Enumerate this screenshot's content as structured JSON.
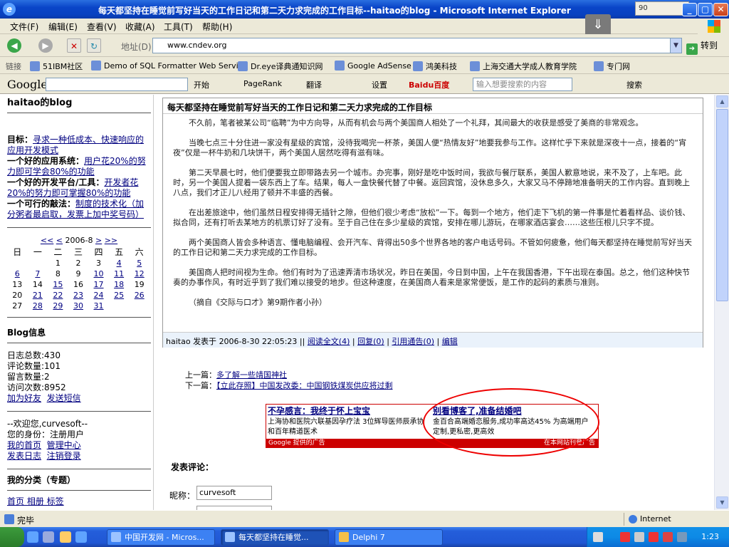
{
  "window": {
    "title": "每天都坚持在睡觉前写好当天的工作日记和第二天力求完成的工作目标--haitao的blog - Microsoft Internet Explorer",
    "tray_top_text": "90"
  },
  "menu": [
    "文件(F)",
    "编辑(E)",
    "查看(V)",
    "收藏(A)",
    "工具(T)",
    "帮助(H)"
  ],
  "address": {
    "label": "地址(D)",
    "url": "www.cndev.org",
    "go_label": "转到"
  },
  "links": {
    "label": "链接",
    "items": [
      "51IBM社区",
      "Demo of SQL Formatter Web Service",
      "Dr.eye译典通知识网",
      "Google AdSense",
      "鸿美科技",
      "上海交通大学成人教育学院",
      "专门网"
    ]
  },
  "google_bar": {
    "logo": "Google",
    "start": "开始",
    "pagerank": "PageRank",
    "translate": "翻译",
    "settings": "设置",
    "baidu": "Baidu百度",
    "baidu_placeholder": "输入想要搜索的内容",
    "search": "搜索"
  },
  "sidebar": {
    "blog_name": "haitao的blog",
    "goal_label": "目标：",
    "goal_text": "寻求一种低成本、快速响应的应用开发模式",
    "app_label": "一个好的应用系统：",
    "app_text": "用户花20%的努力即可学会80%的功能",
    "tool_label": "一个好的开发平台/工具：",
    "tool_text": "开发者花20%的努力即可掌握80%的功能",
    "law_label": "一个可行的敲法：",
    "law_text": "制度的技术化（加分粥者最启取，发票上加中奖号码）",
    "calendar": {
      "nav_prev_year": "<<",
      "nav_prev": "<",
      "month": "2006-8",
      "nav_next": ">",
      "nav_next_year": ">>",
      "weekdays": [
        "日",
        "一",
        "二",
        "三",
        "四",
        "五",
        "六"
      ],
      "weeks": [
        [
          "",
          "",
          "1",
          "2",
          "3",
          "4",
          "5"
        ],
        [
          "6",
          "7",
          "8",
          "9",
          "10",
          "11",
          "12"
        ],
        [
          "13",
          "14",
          "15",
          "16",
          "17",
          "18",
          "19"
        ],
        [
          "20",
          "21",
          "22",
          "23",
          "24",
          "25",
          "26"
        ],
        [
          "27",
          "28",
          "29",
          "30",
          "31",
          "",
          ""
        ]
      ],
      "linked_days": [
        "4",
        "5",
        "6",
        "7",
        "10",
        "11",
        "12",
        "15",
        "17",
        "18",
        "21",
        "22",
        "23",
        "24",
        "25",
        "26",
        "28",
        "29",
        "30",
        "31"
      ]
    },
    "info_title": "Blog信息",
    "stats": [
      "日志总数:430",
      "评论数量:101",
      "留言数量:2",
      "访问次数:8952"
    ],
    "add_friend": "加为好友",
    "send_msg": "发送短信",
    "welcome": "--欢迎您,curvesoft--",
    "role": "您的身份：注册用户",
    "my_home": "我的首页",
    "admin": "管理中心",
    "post_log": "发表日志",
    "logout": "注销登录",
    "category_title": "我的分类（专题）",
    "category_cut": "首页  相册  标签"
  },
  "post": {
    "title": "每天都坚持在睡觉前写好当天的工作日记和第二天力求完成的工作目标",
    "paragraphs": [
      "不久前，笔者被某公司“临聘”为中方向导，从而有机会与两个美国商人相处了一个礼拜，其间最大的收获是感受了美商的非常观念。",
      "当晚七点三十分住进一家没有星级的宾馆，没待我喝完一杯茶，美国人便“热情友好”地要我参与工作。这样忙乎下来就是深夜十一点，接着的“宵夜”仅是一杯牛奶和几块饼干，两个美国人居然吃得有滋有味。",
      "第二天早晨七时，他们便要我立即带路去另一个城市。办完事，刚好是吃中饭时间，我欲与餐厅联系，美国人歉意地说，来不及了，上车吧。此时，另一个美国人提着一袋东西上了车。结果，每人一盒快餐代替了中餐。返回宾馆，没休息多久，大家又马不停蹄地准备明天的工作内容。直到晚上八点，我们才正儿八经用了顿并不丰盛的西餐。",
      "在出差旅途中，他们虽然日程安排得无插针之隙，但他们很少考虑“放松”一下。每到一个地方，他们走下飞机的第一件事是忙着看样品、谈价钱、拟合同，还有打听去某地方的机票订好了没有。至于自己住在多少星级的宾馆，安排在哪儿游玩，在哪家酒店宴会……这些压根儿只字不提。",
      "两个美国商人皆会多种语言、懂电脑编程、会开汽车、背得出50多个世界各地的客户电话号码。不管如何疲惫，他们每天都坚持在睡觉前写好当天的工作日记和第二天力求完成的工作目标。",
      "美国商人把时间视为生命。他们有时为了迅速弄清市场状况，昨日在美国，今日到中国，上午在我国香港，下午出现在泰国。总之，他们这种快节奏的办事作风，有时近乎到了我们难以接受的地步。但这种速度，在美国商人看来是家常便饭，是工作的起码的素质与准则。",
      "（摘自《交际与口才》第9期作者小孙）"
    ],
    "author": "haitao",
    "posted_at_label": "发表于",
    "posted_at": "2006-8-30 22:05:23",
    "sep": "||",
    "read_full": "阅读全文(4)",
    "reply": "回复(0)",
    "trackback": "引用通告(0)",
    "edit": "编辑"
  },
  "nav": {
    "prev_label": "上一篇：",
    "prev_title": "多了解一些靖国神社",
    "next_label": "下一篇：",
    "next_title": "【立此存照】中国发改委：中国钢铁煤炭供应将过剩"
  },
  "ad": {
    "ad1_title": "不孕感言：我终于怀上宝宝",
    "ad1_text": "上海协和医院六联基因孕疗法 3位辉导医师辰承协和百年精道医术",
    "ad2_title": "别看博客了,准备结婚吧",
    "ad2_text": "金百合高端婚恋服务,成功率高达45% 为高端用户定制,更私密,更高效",
    "footer_left": "Google 提供的广告",
    "footer_right": "在本网站刊登广告"
  },
  "comment": {
    "title": "发表评论：",
    "nick_label": "昵称：",
    "nick_value": "curvesoft"
  },
  "status": {
    "text": "完毕",
    "zone": "Internet"
  },
  "taskbar": {
    "tasks": [
      "中国开发网 - Micros...",
      "每天都坚持在睡觉...",
      "Delphi 7"
    ],
    "clock": "1:23"
  },
  "colors": {
    "link": "#000080",
    "ad_red": "#cc0000",
    "titlebar": "#0a45c8"
  }
}
